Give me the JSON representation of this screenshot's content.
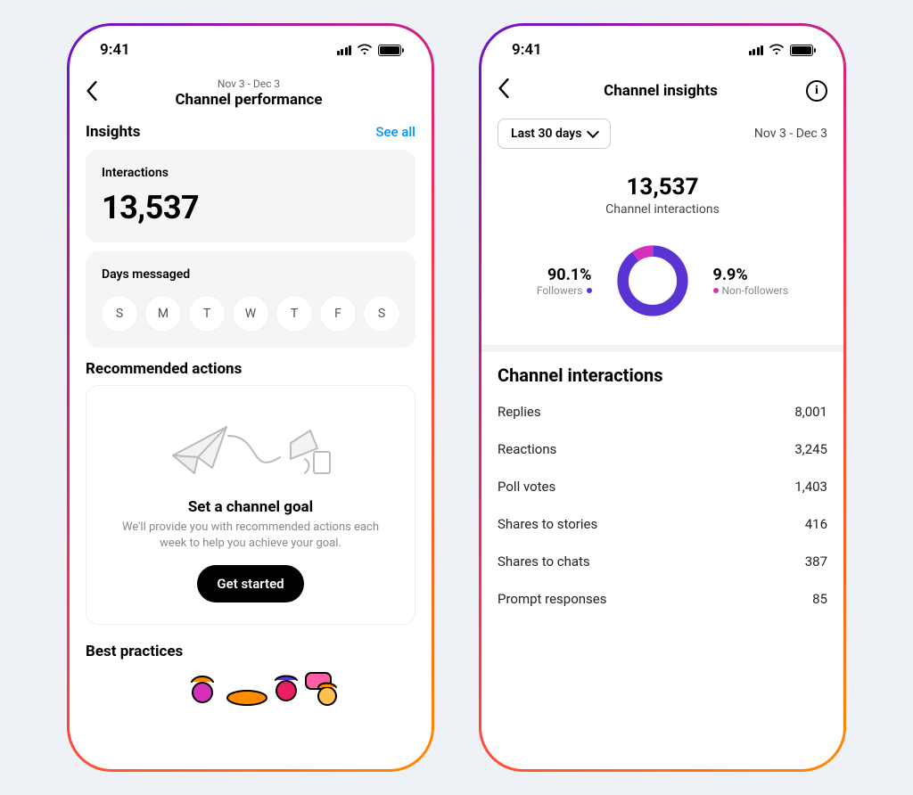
{
  "chart_data": {
    "type": "pie",
    "title": "Channel interactions",
    "series": [
      {
        "name": "Followers",
        "value": 90.1,
        "color": "#5b32d4"
      },
      {
        "name": "Non-followers",
        "value": 9.9,
        "color": "#d62fbb"
      }
    ]
  },
  "status": {
    "time": "9:41"
  },
  "phone1": {
    "nav": {
      "subtitle": "Nov 3 - Dec 3",
      "title": "Channel performance"
    },
    "insights": {
      "heading": "Insights",
      "see_all": "See all",
      "interactions": {
        "label": "Interactions",
        "value": "13,537"
      },
      "days": {
        "label": "Days messaged",
        "items": [
          "S",
          "M",
          "T",
          "W",
          "T",
          "F",
          "S"
        ]
      }
    },
    "recommended": {
      "heading": "Recommended actions",
      "title": "Set a channel goal",
      "desc": "We'll provide you with recommended actions each week to help you achieve your goal.",
      "cta": "Get started"
    },
    "best_practices": {
      "heading": "Best practices"
    }
  },
  "phone2": {
    "nav": {
      "title": "Channel insights"
    },
    "filter": {
      "label": "Last 30 days",
      "range": "Nov 3 - Dec 3"
    },
    "hero": {
      "value": "13,537",
      "label": "Channel interactions"
    },
    "donut": {
      "followers_pct": "90.1%",
      "followers_label": "Followers",
      "nonfollowers_pct": "9.9%",
      "nonfollowers_label": "Non-followers"
    },
    "breakdown": {
      "heading": "Channel interactions",
      "rows": [
        {
          "k": "Replies",
          "v": "8,001"
        },
        {
          "k": "Reactions",
          "v": "3,245"
        },
        {
          "k": "Poll votes",
          "v": "1,403"
        },
        {
          "k": "Shares to stories",
          "v": "416"
        },
        {
          "k": "Shares to chats",
          "v": "387"
        },
        {
          "k": "Prompt responses",
          "v": "85"
        }
      ]
    }
  }
}
